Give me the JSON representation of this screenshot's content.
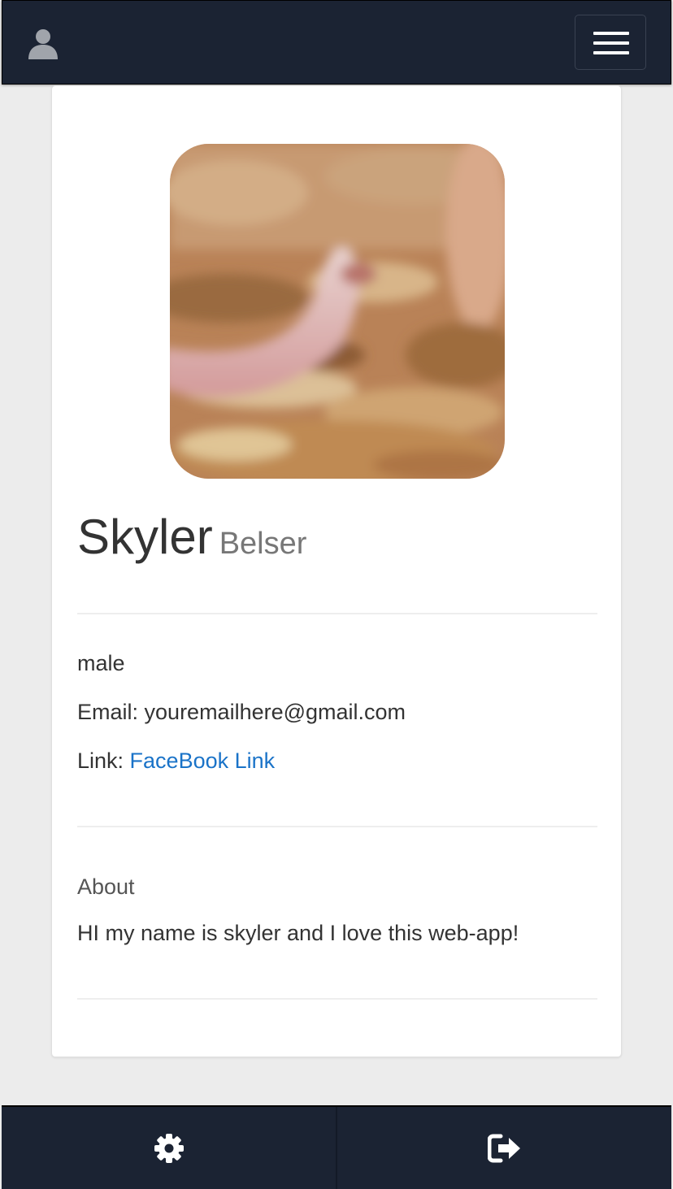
{
  "navbar": {
    "user_icon": "user-icon",
    "menu_icon": "hamburger-menu-icon",
    "background": "#1b2333"
  },
  "profile": {
    "avatar_description_icon": "profile-photo",
    "first_name": "Skyler",
    "last_name": "Belser",
    "gender": "male",
    "email_label": "Email: ",
    "email": "youremailhere@gmail.com",
    "link_label": "Link: ",
    "link_text": "FaceBook Link",
    "link_color": "#1a73c8"
  },
  "about": {
    "heading": "About",
    "text": "HI my name is skyler and I love this web-app!"
  },
  "footer": {
    "settings_icon": "gear-icon",
    "logout_icon": "logout-icon"
  }
}
